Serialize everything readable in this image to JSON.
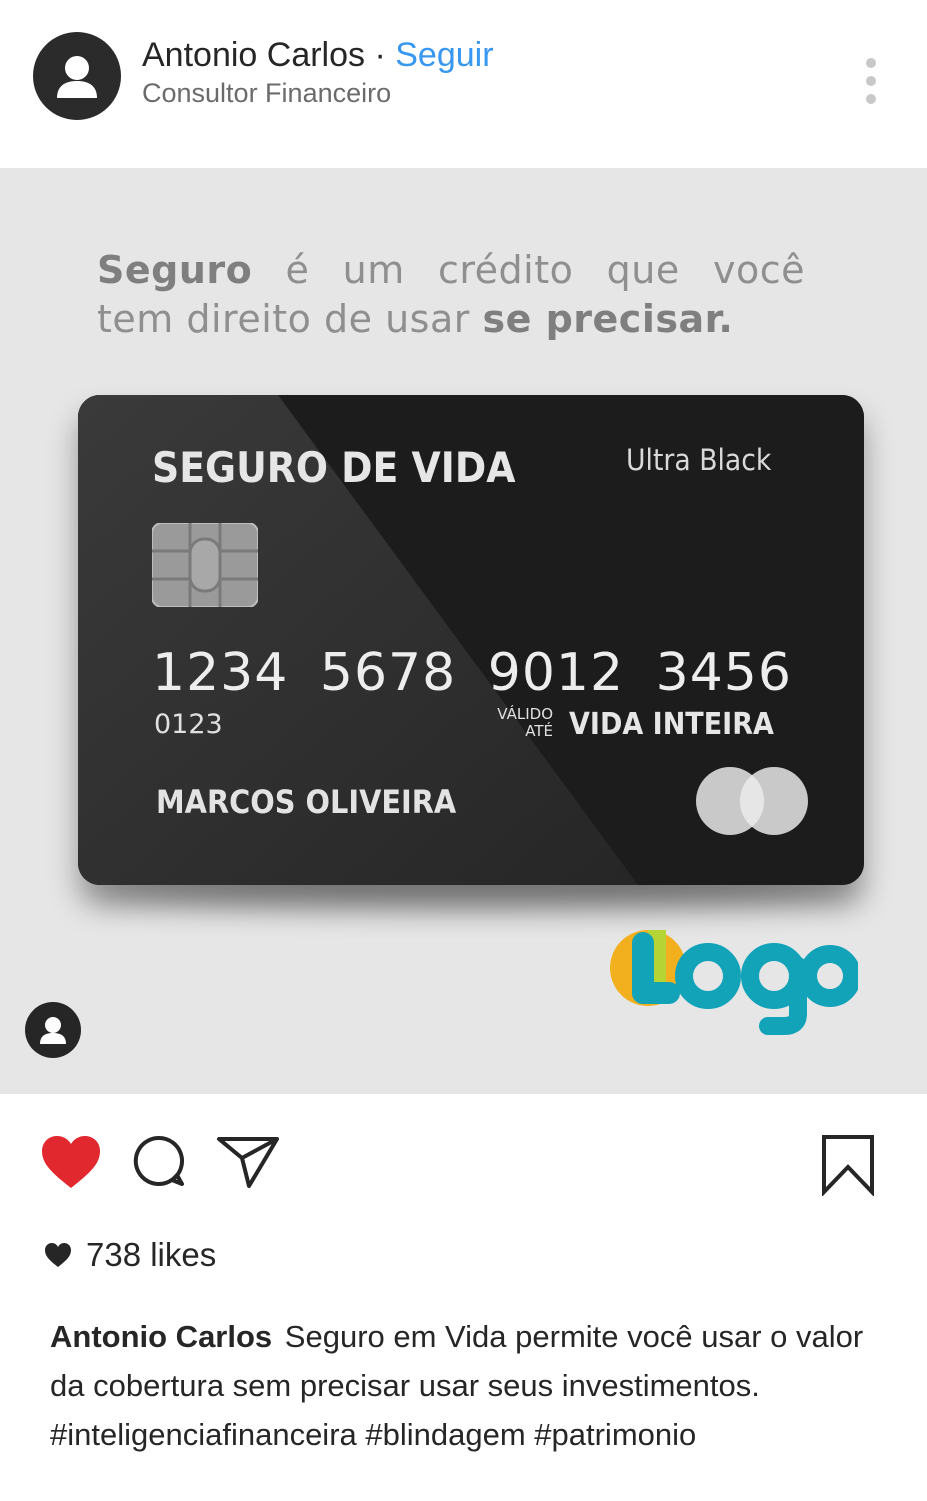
{
  "header": {
    "user_name": "Antonio Carlos",
    "separator": "·",
    "follow_label": "Seguir",
    "subtitle": "Consultor Financeiro",
    "avatar_icon": "user-silhouette-icon",
    "more_icon": "more-vertical-icon"
  },
  "post": {
    "headline": {
      "bold_word": "Seguro",
      "line1_words": [
        "é",
        "um",
        "crédito",
        "que",
        "você"
      ],
      "line2_text": "tem direito de usar",
      "line2_bold": "se precisar."
    },
    "card": {
      "title": "SEGURO DE VIDA",
      "tier": "Ultra Black",
      "number_groups": [
        "1234",
        "5678",
        "9012",
        "3456"
      ],
      "code": "0123",
      "valid_label_1": "VÁLIDO",
      "valid_label_2": "ATÉ",
      "valid_value": "VIDA INTEIRA",
      "holder_name": "MARCOS OLIVEIRA",
      "chip_icon": "card-chip-icon",
      "network_icon": "card-network-circles-icon"
    },
    "logo_text": "Logo",
    "tag_icon": "user-tag-icon",
    "colors": {
      "background": "#e6e6e6",
      "card": "#1d1d1d",
      "logo_teal": "#12a3b8",
      "logo_yellow": "#f2b01e",
      "logo_green": "#b6d433"
    }
  },
  "actions": {
    "like_icon": "heart-filled-icon",
    "comment_icon": "comment-icon",
    "share_icon": "send-icon",
    "save_icon": "bookmark-icon",
    "like_color": "#e0282e"
  },
  "likes": {
    "count_text": "738 likes",
    "icon": "heart-small-icon"
  },
  "caption": {
    "user": "Antonio Carlos",
    "text": "Seguro em Vida permite você usar o valor da cobertura sem precisar usar seus investimentos. #inteligenciafinanceira #blindagem #patrimonio"
  }
}
